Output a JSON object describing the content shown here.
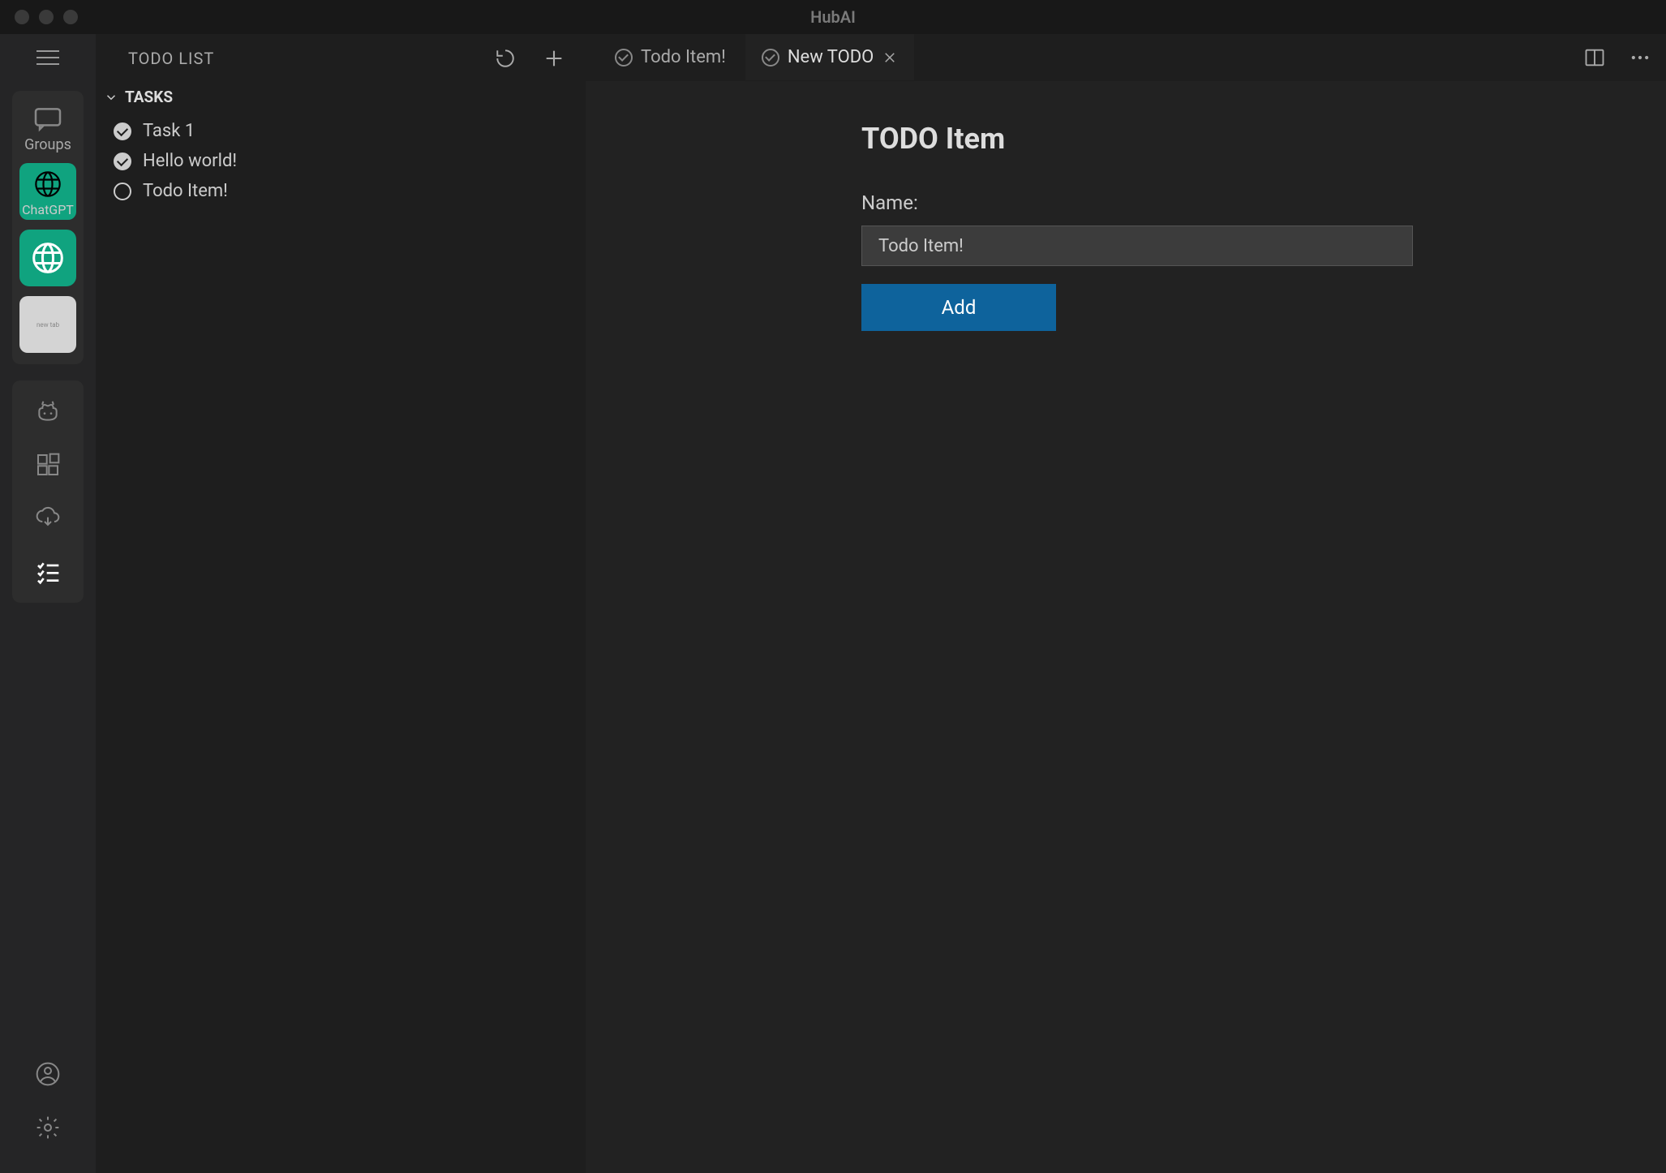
{
  "window": {
    "title": "HubAI"
  },
  "activity_bar": {
    "groups_label": "Groups",
    "chatgpt_label": "ChatGPT"
  },
  "sidebar": {
    "title": "TODO LIST",
    "section_title": "TASKS",
    "tasks": [
      {
        "label": "Task 1",
        "done": true
      },
      {
        "label": "Hello world!",
        "done": true
      },
      {
        "label": "Todo Item!",
        "done": false
      }
    ]
  },
  "tabs": [
    {
      "label": "Todo Item!",
      "active": false,
      "closable": false
    },
    {
      "label": "New TODO",
      "active": true,
      "closable": true
    }
  ],
  "form": {
    "heading": "TODO Item",
    "name_label": "Name:",
    "name_value": "Todo Item!",
    "add_label": "Add"
  }
}
